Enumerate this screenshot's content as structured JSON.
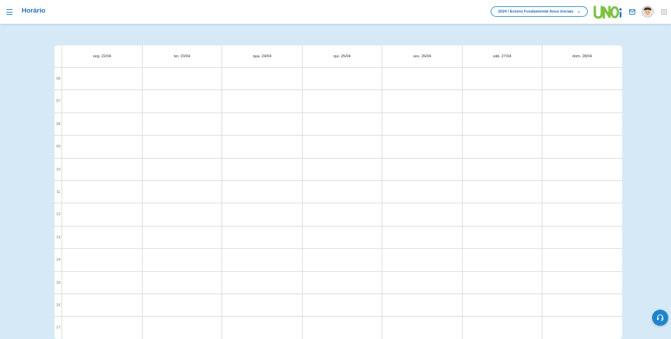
{
  "header": {
    "title": "Horário",
    "year_selector": "2024 / Ensino Fundamental Anos Iniciais",
    "logo_text": "UNOi",
    "icons": [
      "menu-icon",
      "mail-icon",
      "avatar",
      "apps-grid-icon"
    ]
  },
  "calendar": {
    "days": [
      "seg. 22/04",
      "ter. 23/04",
      "qua. 24/04",
      "qui. 25/04",
      "sex. 26/04",
      "sáb. 27/04",
      "dom. 28/04"
    ],
    "hours": [
      "06",
      "07",
      "08",
      "09",
      "10",
      "11",
      "12",
      "13",
      "14",
      "15",
      "16",
      "17"
    ]
  },
  "floating_button": {
    "icon": "support-icon"
  },
  "colors": {
    "accent": "#1f78c4",
    "background": "#d5eaf6",
    "grid_line": "#dcdcdc",
    "logo_green": "#7cc242"
  }
}
